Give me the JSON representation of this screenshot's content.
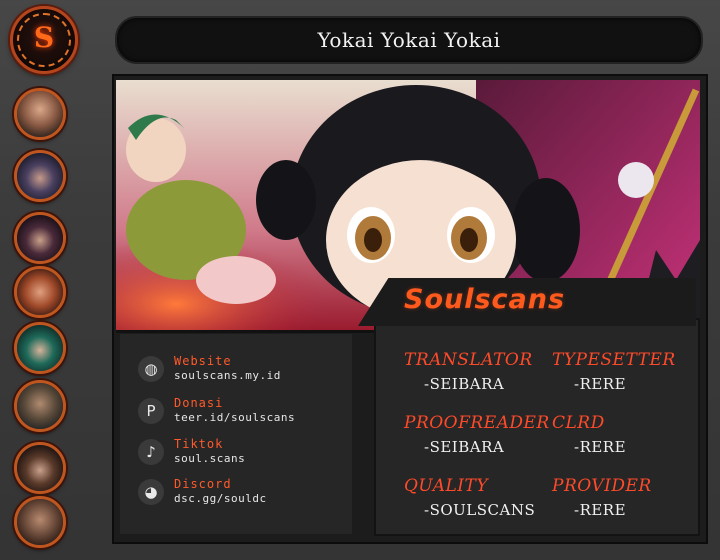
{
  "title": "Yokai Yokai Yokai",
  "brand": "Soulscans",
  "logo": {
    "glyph": "S",
    "icon": "soulscans-logo-icon"
  },
  "avatars": [
    "avatar-1",
    "avatar-2",
    "avatar-3",
    "avatar-4",
    "avatar-5",
    "avatar-6",
    "avatar-7",
    "avatar-8"
  ],
  "contacts": [
    {
      "label": "Website",
      "value": "soulscans.my.id",
      "icon": "globe-icon",
      "glyph": "◍"
    },
    {
      "label": "Donasi",
      "value": "teer.id/soulscans",
      "icon": "paypal-icon",
      "glyph": "P"
    },
    {
      "label": "Tiktok",
      "value": "soul.scans",
      "icon": "tiktok-icon",
      "glyph": "♪"
    },
    {
      "label": "Discord",
      "value": "dsc.gg/souldc",
      "icon": "discord-icon",
      "glyph": "◕"
    }
  ],
  "credits": [
    {
      "role": "TRANSLATOR",
      "name": "-SEIBARA"
    },
    {
      "role": "TYPESETTER",
      "name": "-RERE"
    },
    {
      "role": "PROOFREADER",
      "name": "-SEIBARA"
    },
    {
      "role": "CLRD",
      "name": "-RERE"
    },
    {
      "role": "QUALITY",
      "name": "-SOULSCANS"
    },
    {
      "role": "PROVIDER",
      "name": "-RERE"
    }
  ],
  "colors": {
    "accent": "#ff5a1e",
    "role": "#ff4a2a",
    "panel": "#1c1c1c"
  }
}
